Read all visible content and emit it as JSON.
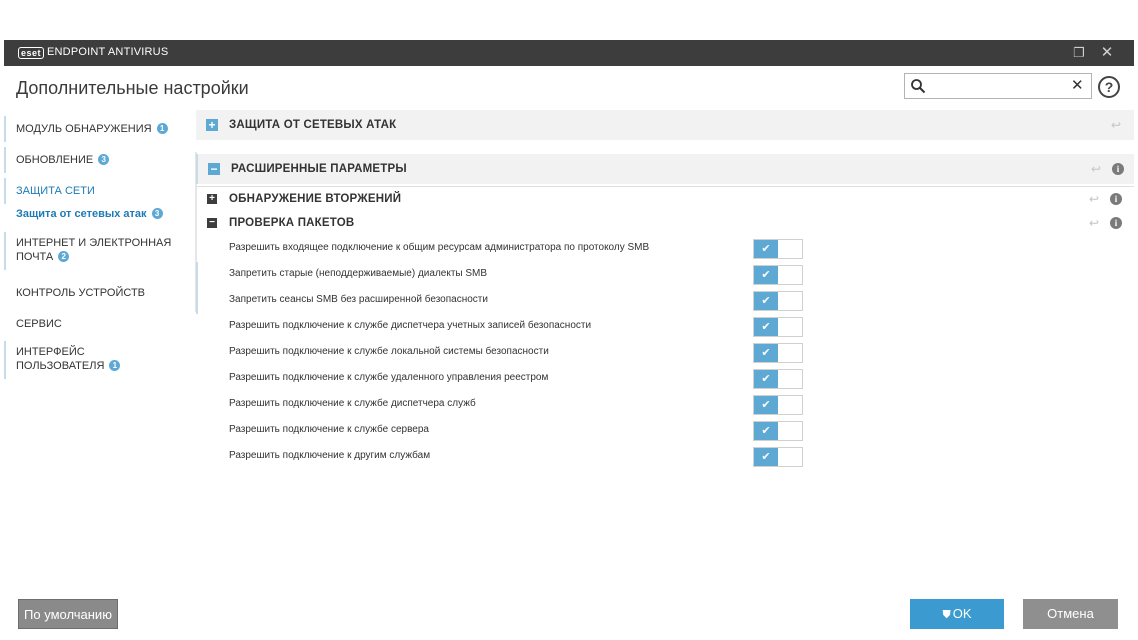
{
  "titlebar": {
    "logo": "eset",
    "app_name": "ENDPOINT ANTIVIRUS",
    "restore_icon": "restore-icon",
    "close_icon": "close-icon"
  },
  "header": {
    "title": "Дополнительные настройки",
    "search_value": "",
    "search_placeholder": "",
    "help_label": "?"
  },
  "sidebar": {
    "items": [
      {
        "label": "МОДУЛЬ ОБНАРУЖЕНИЯ",
        "badge": "1"
      },
      {
        "label": "ОБНОВЛЕНИЕ",
        "badge": "3"
      },
      {
        "label": "ЗАЩИТА СЕТИ",
        "badge": ""
      },
      {
        "label": "Защита от сетевых атак",
        "badge": "3"
      },
      {
        "label_line1": "ИНТЕРНЕТ И ЭЛЕКТРОННАЯ",
        "label_line2": "ПОЧТА",
        "badge": "2"
      },
      {
        "label": "КОНТРОЛЬ УСТРОЙСТВ",
        "badge": ""
      },
      {
        "label": "СЕРВИС",
        "badge": ""
      },
      {
        "label_line1": "ИНТЕРФЕЙС",
        "label_line2": "ПОЛЬЗОВАТЕЛЯ",
        "badge": "1"
      }
    ]
  },
  "content": {
    "sections": [
      {
        "title": "ЗАЩИТА ОТ СЕТЕВЫХ АТАК",
        "expander": "+"
      },
      {
        "title": "РАСШИРЕННЫЕ ПАРАМЕТРЫ",
        "expander": "−"
      }
    ],
    "subsections": [
      {
        "title": "ОБНАРУЖЕНИЕ ВТОРЖЕНИЙ",
        "expander": "+"
      },
      {
        "title": "ПРОВЕРКА ПАКЕТОВ",
        "expander": "−"
      }
    ],
    "settings": [
      {
        "label": "Разрешить входящее подключение к общим ресурсам администратора по протоколу SMB",
        "enabled": true
      },
      {
        "label": "Запретить старые (неподдерживаемые) диалекты SMB",
        "enabled": true
      },
      {
        "label": "Запретить сеансы SMB без расширенной безопасности",
        "enabled": true
      },
      {
        "label": "Разрешить подключение к службе диспетчера учетных записей безопасности",
        "enabled": true
      },
      {
        "label": "Разрешить подключение к службе локальной системы безопасности",
        "enabled": true
      },
      {
        "label": "Разрешить подключение к службе удаленного управления реестром",
        "enabled": true
      },
      {
        "label": "Разрешить подключение к службе диспетчера служб",
        "enabled": true
      },
      {
        "label": "Разрешить подключение к службе сервера",
        "enabled": true
      },
      {
        "label": "Разрешить подключение к другим службам",
        "enabled": true
      }
    ],
    "toggle_check": "✔",
    "revert_icon": "↩",
    "info_icon": "i"
  },
  "footer": {
    "default_label": "По умолчанию",
    "ok_label": "OK",
    "cancel_label": "Отмена"
  },
  "colors": {
    "accent": "#5ea9d4",
    "titlebar": "#3d3d3d",
    "ok": "#3b9bd1",
    "muted_button": "#8f8f8f"
  }
}
